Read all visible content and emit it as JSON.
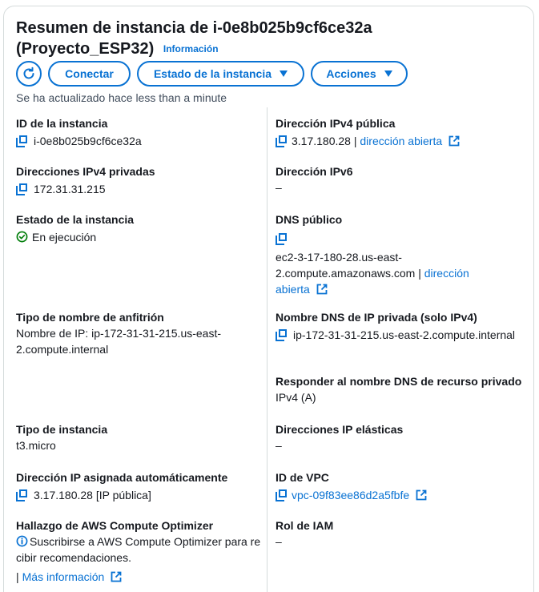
{
  "header": {
    "title": "Resumen de instancia de i-0e8b025b9cf6ce32a (Proyecto_ESP32)",
    "info_link": "Información",
    "buttons": {
      "connect": "Conectar",
      "instance_state": "Estado de la instancia",
      "actions": "Acciones"
    },
    "updated": "Se ha actualizado hace less than a minute"
  },
  "left": {
    "instance_id": {
      "label": "ID de la instancia",
      "value": "i-0e8b025b9cf6ce32a"
    },
    "private_ipv4": {
      "label": "Direcciones IPv4 privadas",
      "value": "172.31.31.215"
    },
    "instance_state": {
      "label": "Estado de la instancia",
      "value": "En ejecución"
    },
    "hostname_type": {
      "label": "Tipo de nombre de anfitrión",
      "value": "Nombre de IP: ip-172-31-31-215.us-east-2.compute.internal"
    },
    "instance_type": {
      "label": "Tipo de instancia",
      "value": "t3.micro"
    },
    "auto_ip": {
      "label": "Dirección IP asignada automáticamente",
      "value": "3.17.180.28 [IP pública]"
    },
    "optimizer": {
      "label": "Hallazgo de AWS Compute Optimizer",
      "value": "Suscribirse a AWS Compute Optimizer para recibir recomendaciones.",
      "more": "Más información"
    }
  },
  "right": {
    "public_ipv4": {
      "label": "Dirección IPv4 pública",
      "value": "3.17.180.28",
      "link": "dirección abierta"
    },
    "ipv6": {
      "label": "Dirección IPv6",
      "value": "–"
    },
    "public_dns": {
      "label": "DNS público",
      "value": "ec2-3-17-180-28.us-east-2.compute.amazonaws.com",
      "link": "dirección abierta"
    },
    "private_dns": {
      "label": "Nombre DNS de IP privada (solo IPv4)",
      "value": "ip-172-31-31-215.us-east-2.compute.internal"
    },
    "answer_private_dns": {
      "label": "Responder al nombre DNS de recurso privado",
      "value": "IPv4 (A)"
    },
    "elastic_ip": {
      "label": "Direcciones IP elásticas",
      "value": "–"
    },
    "vpc_id": {
      "label": "ID de VPC",
      "value": "vpc-09f83ee86d2a5fbfe"
    },
    "iam_role": {
      "label": "Rol de IAM",
      "value": "–"
    }
  },
  "colors": {
    "accent": "#0972d3",
    "success": "#037f0c",
    "border": "#d5dbdb"
  }
}
